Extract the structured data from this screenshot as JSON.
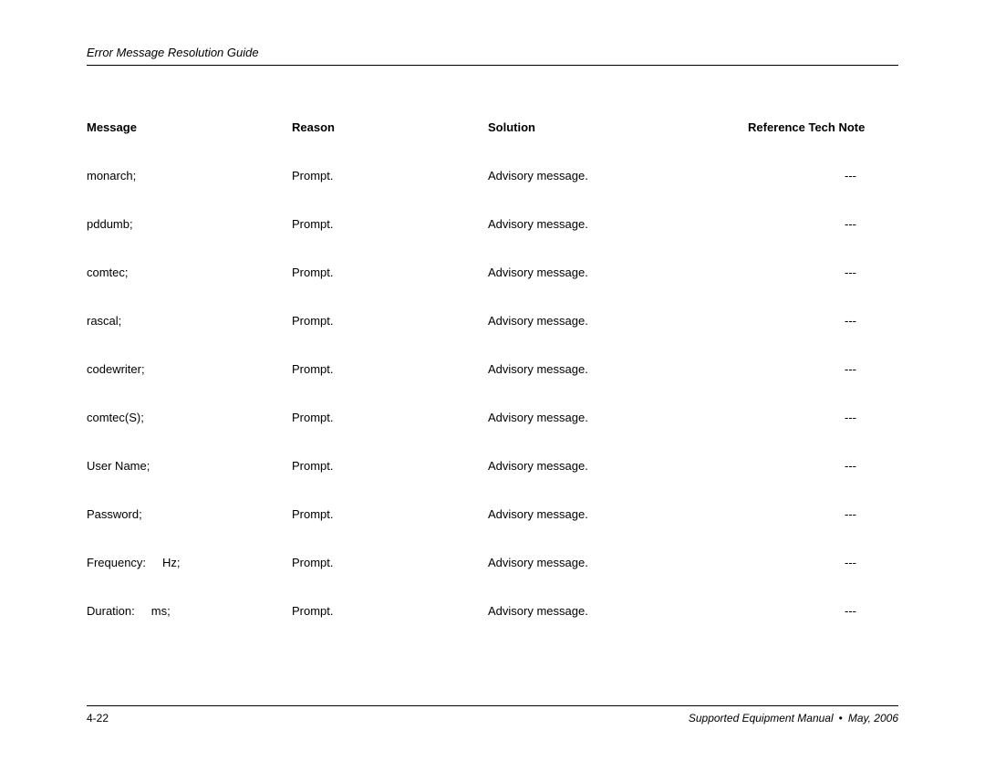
{
  "header": {
    "title": "Error Message Resolution Guide"
  },
  "table": {
    "headers": {
      "message": "Message",
      "reason": "Reason",
      "solution": "Solution",
      "reference": "Reference Tech Note"
    },
    "rows": [
      {
        "message": "monarch;",
        "message2": "",
        "reason": "Prompt.",
        "solution": "Advisory message.",
        "reference": "---"
      },
      {
        "message": "pddumb;",
        "message2": "",
        "reason": "Prompt.",
        "solution": "Advisory message.",
        "reference": "---"
      },
      {
        "message": "comtec;",
        "message2": "",
        "reason": "Prompt.",
        "solution": "Advisory message.",
        "reference": "---"
      },
      {
        "message": "rascal;",
        "message2": "",
        "reason": "Prompt.",
        "solution": "Advisory message.",
        "reference": "---"
      },
      {
        "message": "codewriter;",
        "message2": "",
        "reason": "Prompt.",
        "solution": "Advisory message.",
        "reference": "---"
      },
      {
        "message": "comtec(S);",
        "message2": "",
        "reason": "Prompt.",
        "solution": "Advisory message.",
        "reference": "---"
      },
      {
        "message": "User Name;",
        "message2": "",
        "reason": "Prompt.",
        "solution": "Advisory message.",
        "reference": "---"
      },
      {
        "message": "Password;",
        "message2": "",
        "reason": "Prompt.",
        "solution": "Advisory message.",
        "reference": "---"
      },
      {
        "message": "Frequency:",
        "message2": "Hz;",
        "reason": "Prompt.",
        "solution": "Advisory message.",
        "reference": "---"
      },
      {
        "message": "Duration:",
        "message2": "ms;",
        "reason": "Prompt.",
        "solution": "Advisory message.",
        "reference": "---"
      }
    ]
  },
  "footer": {
    "page": "4-22",
    "manual": "Supported Equipment Manual",
    "date": "May, 2006"
  }
}
